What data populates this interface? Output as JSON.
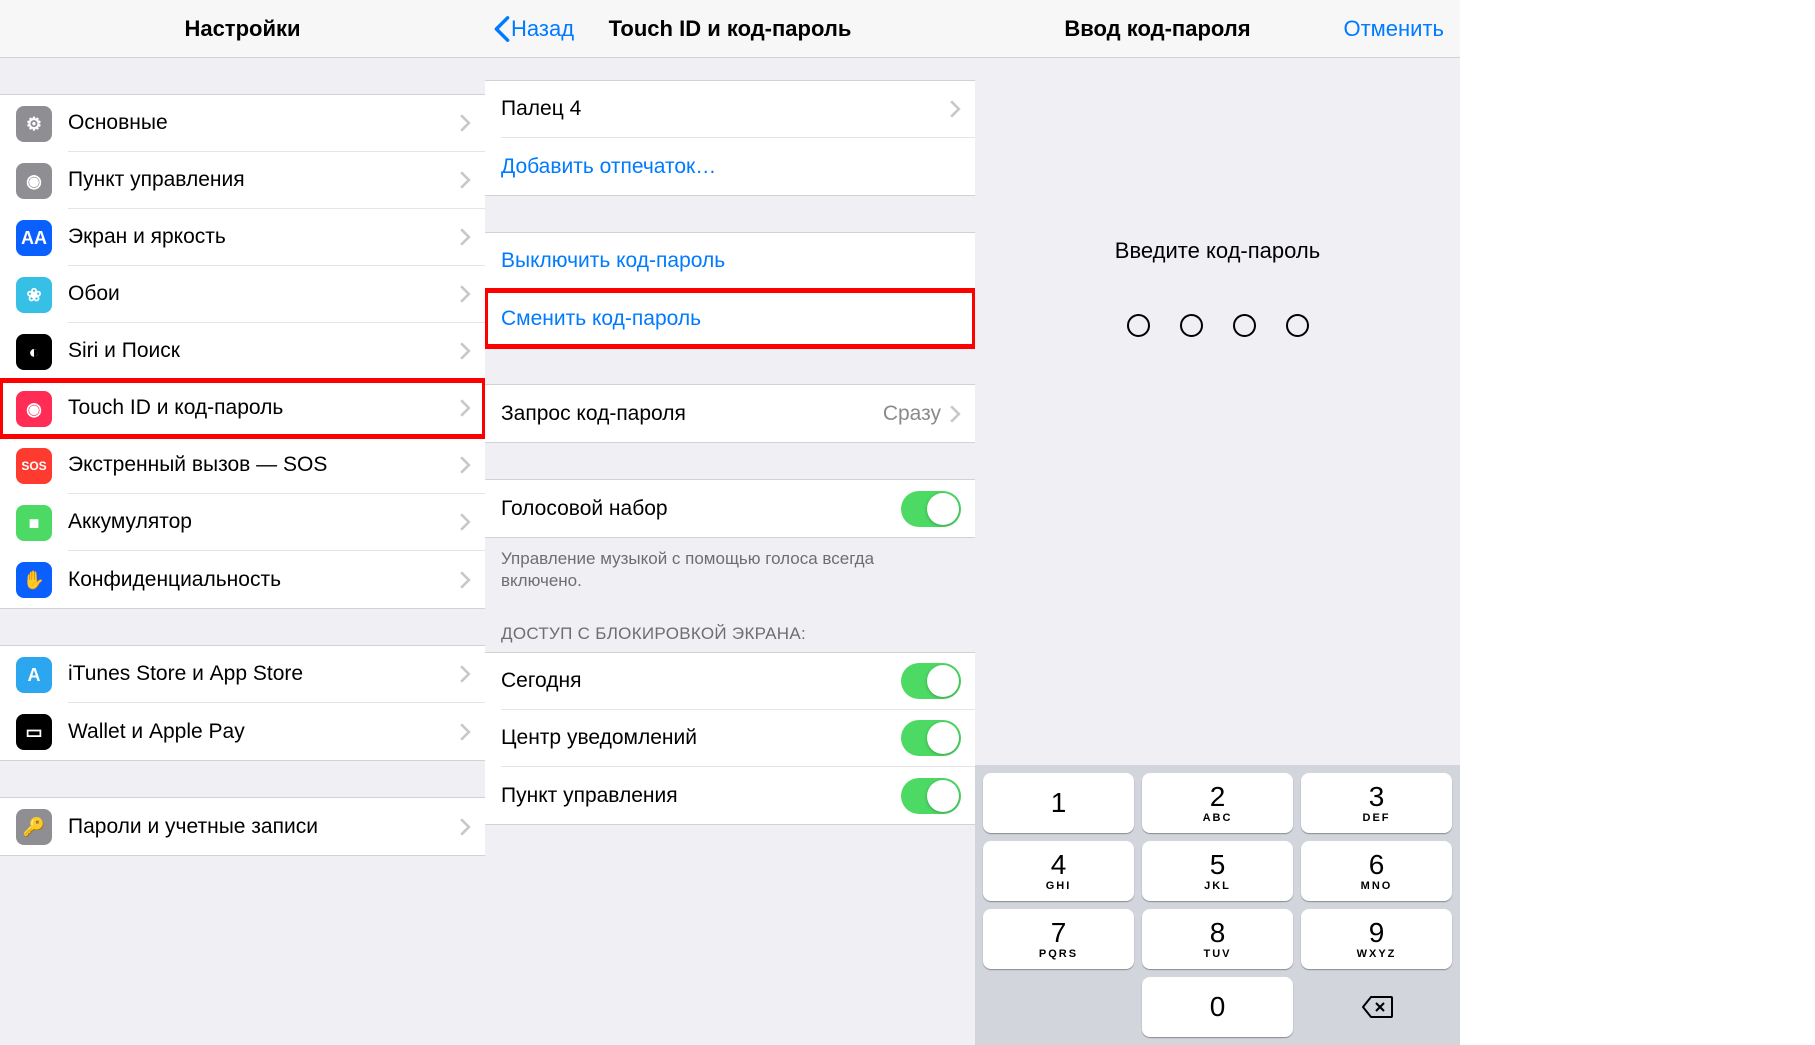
{
  "panel1": {
    "title": "Настройки",
    "groups": [
      [
        {
          "label": "Основные",
          "icon": "gear-icon",
          "iconClass": "ic-gray",
          "glyph": "⚙"
        },
        {
          "label": "Пункт управления",
          "icon": "control-center-icon",
          "iconClass": "ic-gray2",
          "glyph": "◉"
        },
        {
          "label": "Экран и яркость",
          "icon": "display-icon",
          "iconClass": "ic-blue",
          "glyph": "AA"
        },
        {
          "label": "Обои",
          "icon": "wallpaper-icon",
          "iconClass": "ic-cyan",
          "glyph": "❀"
        },
        {
          "label": "Siri и Поиск",
          "icon": "siri-icon",
          "iconClass": "ic-black",
          "glyph": "◐"
        },
        {
          "label": "Touch ID и код-пароль",
          "icon": "touchid-icon",
          "iconClass": "ic-pink",
          "glyph": "◉",
          "highlight": true
        },
        {
          "label": "Экстренный вызов — SOS",
          "icon": "sos-icon",
          "iconClass": "ic-red",
          "glyph": "SOS"
        },
        {
          "label": "Аккумулятор",
          "icon": "battery-icon",
          "iconClass": "ic-green",
          "glyph": "■"
        },
        {
          "label": "Конфиденциальность",
          "icon": "privacy-icon",
          "iconClass": "ic-blue2",
          "glyph": "✋"
        }
      ],
      [
        {
          "label": "iTunes Store и App Store",
          "icon": "appstore-icon",
          "iconClass": "ic-lightblue",
          "glyph": "A"
        },
        {
          "label": "Wallet и Apple Pay",
          "icon": "wallet-icon",
          "iconClass": "ic-wallet",
          "glyph": "▭"
        }
      ],
      [
        {
          "label": "Пароли и учетные записи",
          "icon": "accounts-icon",
          "iconClass": "ic-gray3",
          "glyph": "🔑"
        }
      ]
    ]
  },
  "panel2": {
    "back": "Назад",
    "title": "Touch ID и код-пароль",
    "fingers": {
      "label": "Палец 4"
    },
    "addFingerprint": "Добавить отпечаток…",
    "disablePasscode": "Выключить код-пароль",
    "changePasscode": "Сменить код-пароль",
    "requirePasscode": {
      "label": "Запрос код-пароля",
      "value": "Сразу"
    },
    "voiceDial": {
      "label": "Голосовой набор"
    },
    "voiceDialFooter": "Управление музыкой с помощью голоса всегда включено.",
    "lockScreenHeader": "ДОСТУП С БЛОКИРОВКОЙ ЭКРАНА:",
    "lockScreenItems": [
      "Сегодня",
      "Центр уведомлений",
      "Пункт управления"
    ]
  },
  "panel3": {
    "title": "Ввод код-пароля",
    "cancel": "Отменить",
    "prompt": "Введите код-пароль",
    "keys": [
      {
        "num": "1",
        "sub": ""
      },
      {
        "num": "2",
        "sub": "ABC"
      },
      {
        "num": "3",
        "sub": "DEF"
      },
      {
        "num": "4",
        "sub": "GHI"
      },
      {
        "num": "5",
        "sub": "JKL"
      },
      {
        "num": "6",
        "sub": "MNO"
      },
      {
        "num": "7",
        "sub": "PQRS"
      },
      {
        "num": "8",
        "sub": "TUV"
      },
      {
        "num": "9",
        "sub": "WXYZ"
      },
      {
        "blank": true
      },
      {
        "num": "0",
        "sub": ""
      },
      {
        "del": true
      }
    ]
  }
}
